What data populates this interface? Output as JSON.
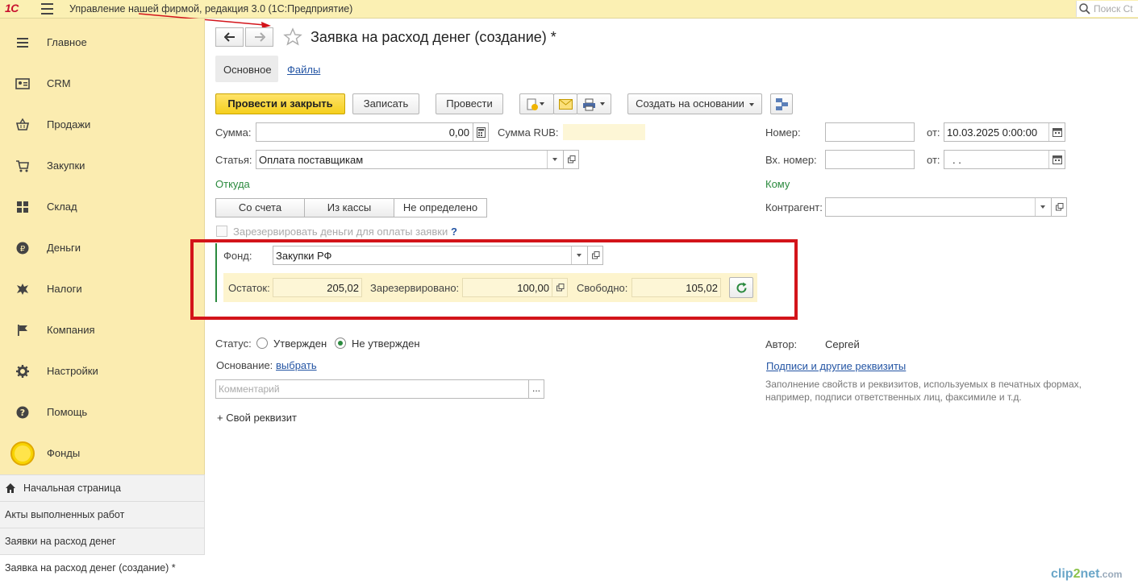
{
  "app": {
    "logo": "1С",
    "title": "Управление нашей фирмой, редакция 3.0  (1С:Предприятие)",
    "search_placeholder": "Поиск Ct"
  },
  "sidebar": {
    "items": [
      {
        "label": "Главное",
        "icon": "menu-lines-icon"
      },
      {
        "label": "CRM",
        "icon": "contact-card-icon"
      },
      {
        "label": "Продажи",
        "icon": "basket-icon"
      },
      {
        "label": "Закупки",
        "icon": "cart-icon"
      },
      {
        "label": "Склад",
        "icon": "warehouse-grid-icon"
      },
      {
        "label": "Деньги",
        "icon": "ruble-coin-icon"
      },
      {
        "label": "Налоги",
        "icon": "emblem-icon"
      },
      {
        "label": "Компания",
        "icon": "flag-icon"
      },
      {
        "label": "Настройки",
        "icon": "gear-icon"
      },
      {
        "label": "Помощь",
        "icon": "question-icon"
      },
      {
        "label": "Фонды",
        "icon": "yellow-circle-icon"
      }
    ]
  },
  "open_windows": [
    {
      "label": "Начальная страница"
    },
    {
      "label": "Акты выполненных работ"
    },
    {
      "label": "Заявки на расход денег"
    },
    {
      "label": "Заявка на расход денег (создание) *"
    }
  ],
  "form": {
    "title": "Заявка на расход денег (создание) *",
    "tabs": {
      "main": "Основное",
      "files": "Файлы"
    },
    "buttons": {
      "post_close": "Провести и закрыть",
      "save": "Записать",
      "post": "Провести",
      "create_based": "Создать на основании"
    },
    "fields": {
      "sum_label": "Сумма:",
      "sum_value": "0,00",
      "sum_rub_label": "Сумма RUB:",
      "number_label": "Номер:",
      "number_value": "",
      "date_label": "от:",
      "date_value": "10.03.2025  0:00:00",
      "article_label": "Статья:",
      "article_value": "Оплата поставщикам",
      "in_number_label": "Вх. номер:",
      "in_number_value": "",
      "in_date_label": "от:",
      "in_date_value": " .  .",
      "from_label": "Откуда",
      "to_label": "Кому",
      "counterparty_label": "Контрагент:",
      "counterparty_value": ""
    },
    "source_options": [
      "Со счета",
      "Из кассы",
      "Не определено"
    ],
    "reserve_checkbox": "Зарезервировать деньги для оплаты заявки",
    "reserve_help": "?",
    "fund": {
      "label": "Фонд:",
      "value": "Закупки РФ",
      "balance_label": "Остаток:",
      "balance_value": "205,02",
      "reserved_label": "Зарезервировано:",
      "reserved_value": "100,00",
      "free_label": "Свободно:",
      "free_value": "105,02"
    },
    "status": {
      "label": "Статус:",
      "option_approved": "Утвержден",
      "option_not_approved": "Не утвержден",
      "selected": "Не утвержден"
    },
    "basis": {
      "label": "Основание:",
      "link": "выбрать"
    },
    "comment_placeholder": "Комментарий",
    "comment_btn": "...",
    "custom_attr": "+ Свой реквизит",
    "author": {
      "label": "Автор:",
      "value": "Сергей"
    },
    "signatures_link": "Подписи и другие реквизиты",
    "signatures_hint": "Заполнение свойств и реквизитов, используемых в печатных формах, например, подписи ответственных лиц, факсимиле и т.д."
  },
  "colors": {
    "accent_yellow": "#f5cf1d",
    "highlight_red": "#d3141a",
    "green": "#2b8a3e",
    "link": "#2455a4"
  },
  "watermark": {
    "part1": "clip",
    "part2": "2",
    "part3": "net",
    "part4": ".com"
  }
}
